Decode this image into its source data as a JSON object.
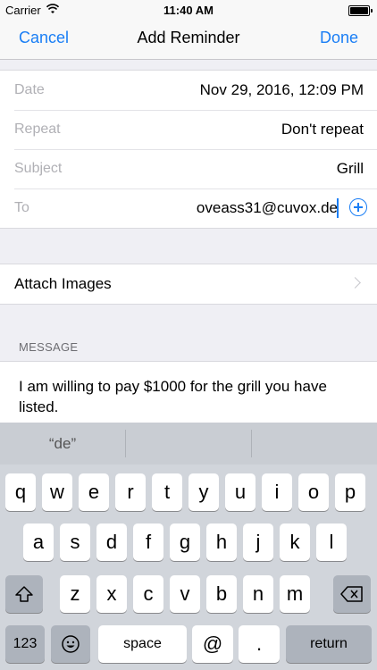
{
  "status": {
    "carrier": "Carrier",
    "time": "11:40 AM"
  },
  "nav": {
    "cancel": "Cancel",
    "title": "Add Reminder",
    "done": "Done"
  },
  "form": {
    "date": {
      "label": "Date",
      "value": "Nov 29, 2016, 12:09 PM"
    },
    "repeat": {
      "label": "Repeat",
      "value": "Don't repeat"
    },
    "subject": {
      "label": "Subject",
      "value": "Grill"
    },
    "to": {
      "label": "To",
      "value": "oveass31@cuvox.de"
    }
  },
  "attach": {
    "label": "Attach Images"
  },
  "message": {
    "header": "MESSAGE",
    "text": "I am willing to pay $1000 for the grill you have listed."
  },
  "keyboard": {
    "suggestions": [
      "“de”",
      "",
      ""
    ],
    "row1": [
      "q",
      "w",
      "e",
      "r",
      "t",
      "y",
      "u",
      "i",
      "o",
      "p"
    ],
    "row2": [
      "a",
      "s",
      "d",
      "f",
      "g",
      "h",
      "j",
      "k",
      "l"
    ],
    "row3": [
      "z",
      "x",
      "c",
      "v",
      "b",
      "n",
      "m"
    ],
    "numbers": "123",
    "space": "space",
    "at": "@",
    "period": ".",
    "return": "return"
  },
  "icons": {
    "wifi": "wifi-icon",
    "battery": "battery-icon",
    "add": "add-contact-icon",
    "chevron": "chevron-right-icon",
    "shift": "shift-icon",
    "delete": "backspace-icon",
    "emoji": "emoji-icon"
  },
  "colors": {
    "accent": "#1a7ef5"
  }
}
